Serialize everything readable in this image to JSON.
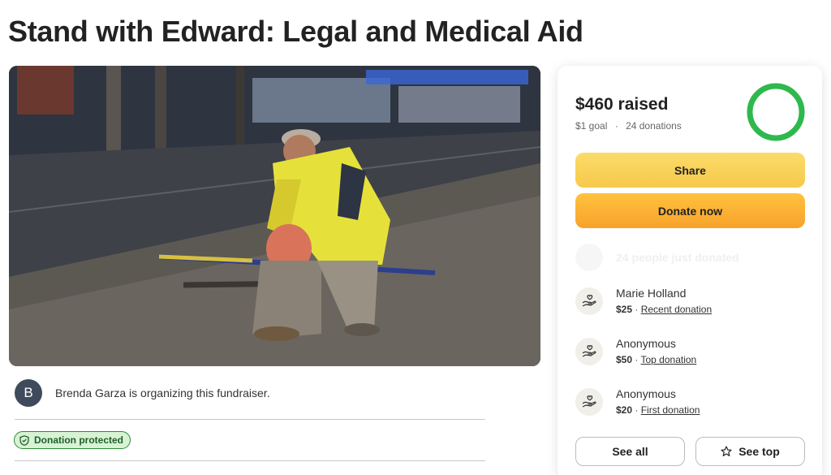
{
  "page": {
    "title": "Stand with Edward: Legal and Medical Aid"
  },
  "organizer": {
    "initial": "B",
    "text": "Brenda Garza is organizing this fundraiser."
  },
  "badge": {
    "label": "Donation protected"
  },
  "summary": {
    "raised": "$460 raised",
    "goal": "$1 goal",
    "dot": "·",
    "donations": "24 donations",
    "progress_fraction": 1.0,
    "ring_color": "#2fb84e"
  },
  "actions": {
    "share": "Share",
    "donate": "Donate now"
  },
  "activity": {
    "recent_text": "24 people just donated"
  },
  "donors": [
    {
      "name": "Marie Holland",
      "amount": "$25",
      "sep": "·",
      "tag": "Recent donation"
    },
    {
      "name": "Anonymous",
      "amount": "$50",
      "sep": "·",
      "tag": "Top donation"
    },
    {
      "name": "Anonymous",
      "amount": "$20",
      "sep": "·",
      "tag": "First donation"
    }
  ],
  "footer_buttons": {
    "see_all": "See all",
    "see_top": "See top"
  },
  "colors": {
    "share_button": "#f6c94a",
    "donate_button": "#f8a22b",
    "badge_bg": "#d8f3d4",
    "badge_border": "#2e8a3a"
  }
}
